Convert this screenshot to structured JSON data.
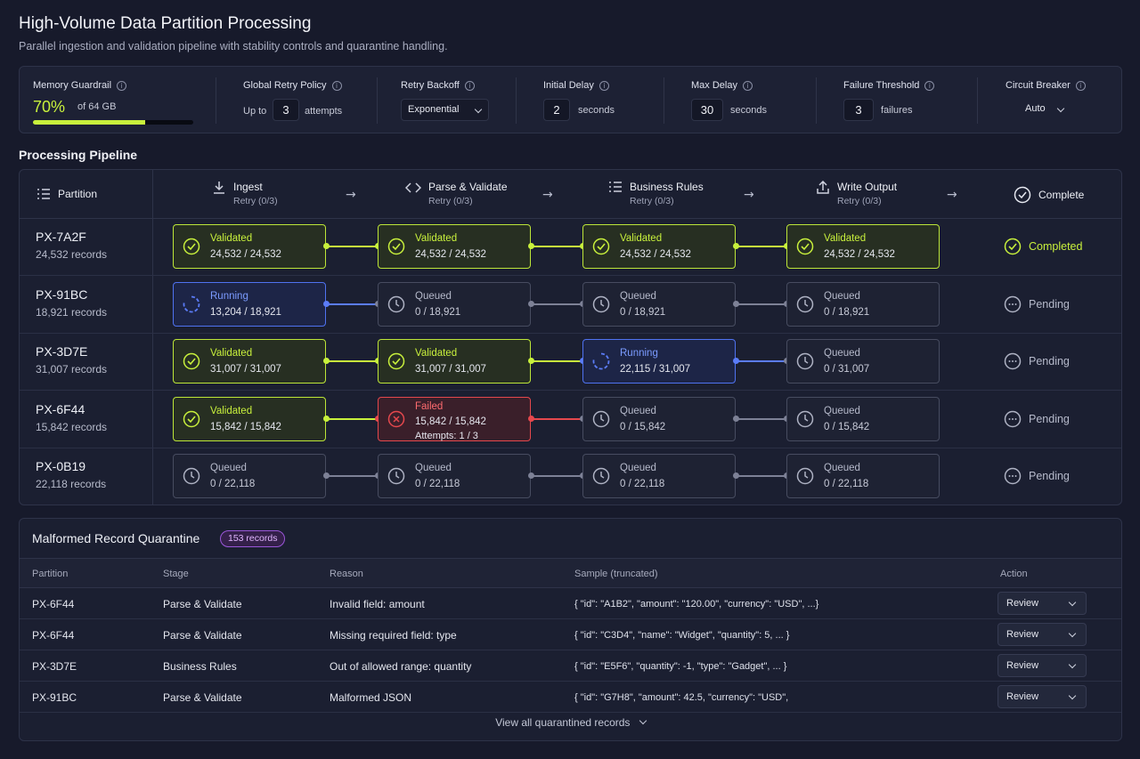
{
  "header": {
    "title": "High-Volume Data Partition Processing",
    "subtitle": "Parallel ingestion and validation pipeline with stability controls and quarantine handling."
  },
  "controls": {
    "memory": {
      "label": "Memory Guardrail",
      "value": "70%",
      "of": "of 64 GB",
      "fraction": 0.7
    },
    "retry": {
      "label": "Global Retry Policy",
      "prefix": "Up to",
      "value": "3",
      "suffix": "attempts"
    },
    "backoff": {
      "label": "Retry Backoff",
      "value": "Exponential"
    },
    "initial_delay": {
      "label": "Initial Delay",
      "value": "2",
      "unit": "seconds"
    },
    "max_delay": {
      "label": "Max Delay",
      "value": "30",
      "unit": "seconds"
    },
    "failure_threshold": {
      "label": "Failure Threshold",
      "value": "3",
      "unit": "failures"
    },
    "circuit_breaker": {
      "label": "Circuit Breaker",
      "value": "Auto"
    }
  },
  "pipeline": {
    "title": "Processing Pipeline",
    "partition_header": "Partition",
    "stages": [
      {
        "name": "Ingest",
        "retry": "Retry (0/3)"
      },
      {
        "name": "Parse & Validate",
        "retry": "Retry (0/3)"
      },
      {
        "name": "Business Rules",
        "retry": "Retry (0/3)"
      },
      {
        "name": "Write Output",
        "retry": "Retry (0/3)"
      }
    ],
    "complete_header": "Complete",
    "rows": [
      {
        "id": "PX-7A2F",
        "records": "24,532 records",
        "final": "Completed",
        "cells": [
          {
            "status": "Validated",
            "progress": "24,532 / 24,532"
          },
          {
            "status": "Validated",
            "progress": "24,532 / 24,532"
          },
          {
            "status": "Validated",
            "progress": "24,532 / 24,532"
          },
          {
            "status": "Validated",
            "progress": "24,532 / 24,532"
          }
        ]
      },
      {
        "id": "PX-91BC",
        "records": "18,921 records",
        "final": "Pending",
        "cells": [
          {
            "status": "Running",
            "progress": "13,204 / 18,921"
          },
          {
            "status": "Queued",
            "progress": "0 / 18,921"
          },
          {
            "status": "Queued",
            "progress": "0 / 18,921"
          },
          {
            "status": "Queued",
            "progress": "0 / 18,921"
          }
        ]
      },
      {
        "id": "PX-3D7E",
        "records": "31,007 records",
        "final": "Pending",
        "cells": [
          {
            "status": "Validated",
            "progress": "31,007 / 31,007"
          },
          {
            "status": "Validated",
            "progress": "31,007 / 31,007"
          },
          {
            "status": "Running",
            "progress": "22,115 / 31,007"
          },
          {
            "status": "Queued",
            "progress": "0 / 31,007"
          }
        ]
      },
      {
        "id": "PX-6F44",
        "records": "15,842 records",
        "final": "Pending",
        "cells": [
          {
            "status": "Validated",
            "progress": "15,842 / 15,842"
          },
          {
            "status": "Failed",
            "progress": "15,842 / 15,842",
            "attempts": "Attempts: 1 / 3"
          },
          {
            "status": "Queued",
            "progress": "0 / 15,842"
          },
          {
            "status": "Queued",
            "progress": "0 / 15,842"
          }
        ]
      },
      {
        "id": "PX-0B19",
        "records": "22,118 records",
        "final": "Pending",
        "cells": [
          {
            "status": "Queued",
            "progress": "0 / 22,118"
          },
          {
            "status": "Queued",
            "progress": "0 / 22,118"
          },
          {
            "status": "Queued",
            "progress": "0 / 22,118"
          },
          {
            "status": "Queued",
            "progress": "0 / 22,118"
          }
        ]
      }
    ]
  },
  "quarantine": {
    "title": "Malformed Record Quarantine",
    "badge": "153 records",
    "columns": [
      "Partition",
      "Stage",
      "Reason",
      "Sample (truncated)",
      "Action"
    ],
    "rows": [
      {
        "partition": "PX-6F44",
        "stage": "Parse & Validate",
        "reason": "Invalid field: amount",
        "sample": "{ \"id\": \"A1B2\", \"amount\": \"120.00\", \"currency\": \"USD\", ...}",
        "action": "Review"
      },
      {
        "partition": "PX-6F44",
        "stage": "Parse & Validate",
        "reason": "Missing required field: type",
        "sample": "{ \"id\": \"C3D4\", \"name\": \"Widget\", \"quantity\": 5, ... }",
        "action": "Review"
      },
      {
        "partition": "PX-3D7E",
        "stage": "Business Rules",
        "reason": "Out of allowed range: quantity",
        "sample": "{ \"id\": \"E5F6\", \"quantity\": -1, \"type\": \"Gadget\", ... }",
        "action": "Review"
      },
      {
        "partition": "PX-91BC",
        "stage": "Parse & Validate",
        "reason": "Malformed JSON",
        "sample": "{ \"id\": \"G7H8\", \"amount\": 42.5, \"currency\": \"USD\",",
        "action": "Review"
      }
    ],
    "footer": "View all quarantined records"
  },
  "colors": {
    "validated": "#c8f03c",
    "running": "#5b7cf7",
    "failed": "#e5484d",
    "queued": "#7d8196"
  }
}
